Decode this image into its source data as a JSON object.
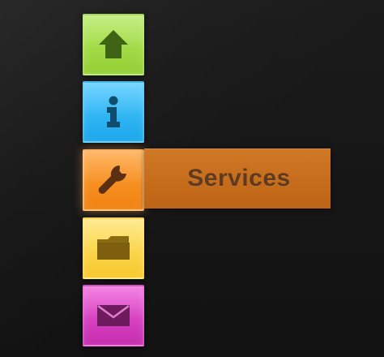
{
  "menu": {
    "items": [
      {
        "id": "home",
        "icon": "home-icon",
        "color": "#a6e14b"
      },
      {
        "id": "info",
        "icon": "info-icon",
        "color": "#33b9f6"
      },
      {
        "id": "services",
        "label": "Services",
        "icon": "wrench-icon",
        "color": "#f9911f",
        "active": true
      },
      {
        "id": "folder",
        "icon": "folder-icon",
        "color": "#fbd54a"
      },
      {
        "id": "mail",
        "icon": "mail-icon",
        "color": "#da43c4"
      }
    ]
  }
}
